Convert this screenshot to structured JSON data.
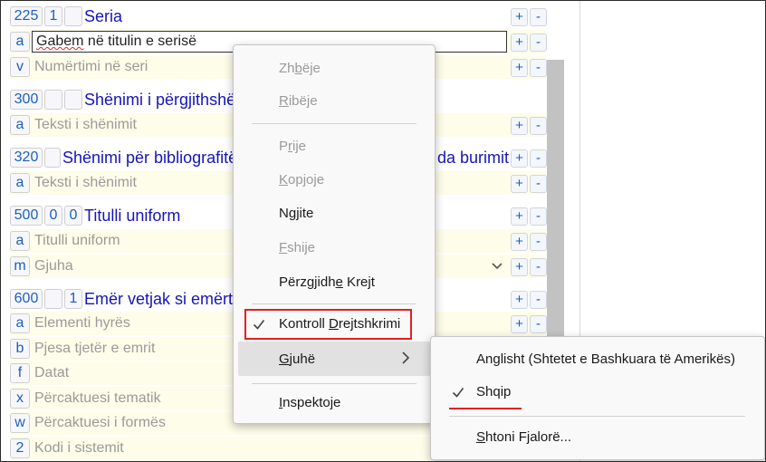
{
  "records": [
    {
      "tag": "225",
      "ind1": "1",
      "ind2": "",
      "title": "Seria",
      "subfields": [
        {
          "code": "a",
          "value": "Gabem në titulin e serisë",
          "active": true
        },
        {
          "code": "v",
          "placeholder": "Numërtimi në seri"
        }
      ]
    },
    {
      "tag": "300",
      "ind1": "",
      "ind2": "",
      "title": "Shënimi i përgjithshë",
      "subfields": [
        {
          "code": "a",
          "placeholder": "Teksti i shënimit"
        }
      ]
    },
    {
      "tag": "320",
      "title": "Shënimi për bibliografitë",
      "title_tail": "da burimit",
      "subfields": [
        {
          "code": "a",
          "placeholder": "Teksti i shënimit"
        }
      ]
    },
    {
      "tag": "500",
      "ind1": "0",
      "ind2": "0",
      "title": "Titulli uniform",
      "subfields": [
        {
          "code": "a",
          "placeholder": "Titulli uniform"
        },
        {
          "code": "m",
          "placeholder": "Gjuha",
          "dropdown": true
        }
      ]
    },
    {
      "tag": "600",
      "ind1": "",
      "ind2": "1",
      "title": "Emër vetjak si emërti",
      "subfields": [
        {
          "code": "a",
          "placeholder": "Elementi hyrës"
        },
        {
          "code": "b",
          "placeholder": "Pjesa tjetër e emrit"
        },
        {
          "code": "f",
          "placeholder": "Datat"
        },
        {
          "code": "x",
          "placeholder": "Përcaktuesi tematik"
        },
        {
          "code": "w",
          "placeholder": "Përcaktuesi i formës"
        },
        {
          "code": "2",
          "placeholder": "Kodi i sistemit"
        }
      ]
    }
  ],
  "buttons": {
    "add": "+",
    "remove": "-"
  },
  "context_menu": {
    "undo": {
      "pre": "Zh",
      "key": "b",
      "post": "ëje",
      "enabled": false
    },
    "redo": {
      "pre": "",
      "key": "R",
      "post": "ibëje",
      "enabled": false
    },
    "cut": {
      "pre": "P",
      "key": "r",
      "post": "ije",
      "enabled": false
    },
    "copy": {
      "pre": "",
      "key": "K",
      "post": "opjoje",
      "enabled": false
    },
    "paste": {
      "pre": "N",
      "key": "g",
      "post": "jite",
      "enabled": true
    },
    "delete": {
      "pre": "",
      "key": "F",
      "post": "shije",
      "enabled": false
    },
    "select_all": {
      "pre": "Përzgjidh",
      "key": "e",
      "post": " Krejt",
      "enabled": true
    },
    "spell_check": {
      "pre": "Kontroll ",
      "key": "D",
      "post": "rejtshkrimi",
      "checked": true
    },
    "languages": {
      "pre": "",
      "key": "G",
      "post": "juhë"
    },
    "inspect": {
      "pre": "",
      "key": "I",
      "post": "nspektoje"
    }
  },
  "submenu": {
    "lang_us": "Anglisht (Shtetet e Bashkuara të Amerikës)",
    "lang_sq": "Shqip",
    "add_dict": {
      "pre": "",
      "key": "S",
      "post": "htoni Fjalorë..."
    }
  },
  "colors": {
    "tag_blue": "#1b5fbf",
    "title_blue": "#1515b8",
    "highlight_red": "#e02020",
    "subfield_bg": "#fefde9"
  },
  "icons": {
    "check": "checkmark-icon",
    "submenu": "chevron-right-icon",
    "dropdown": "chevron-down-icon"
  }
}
